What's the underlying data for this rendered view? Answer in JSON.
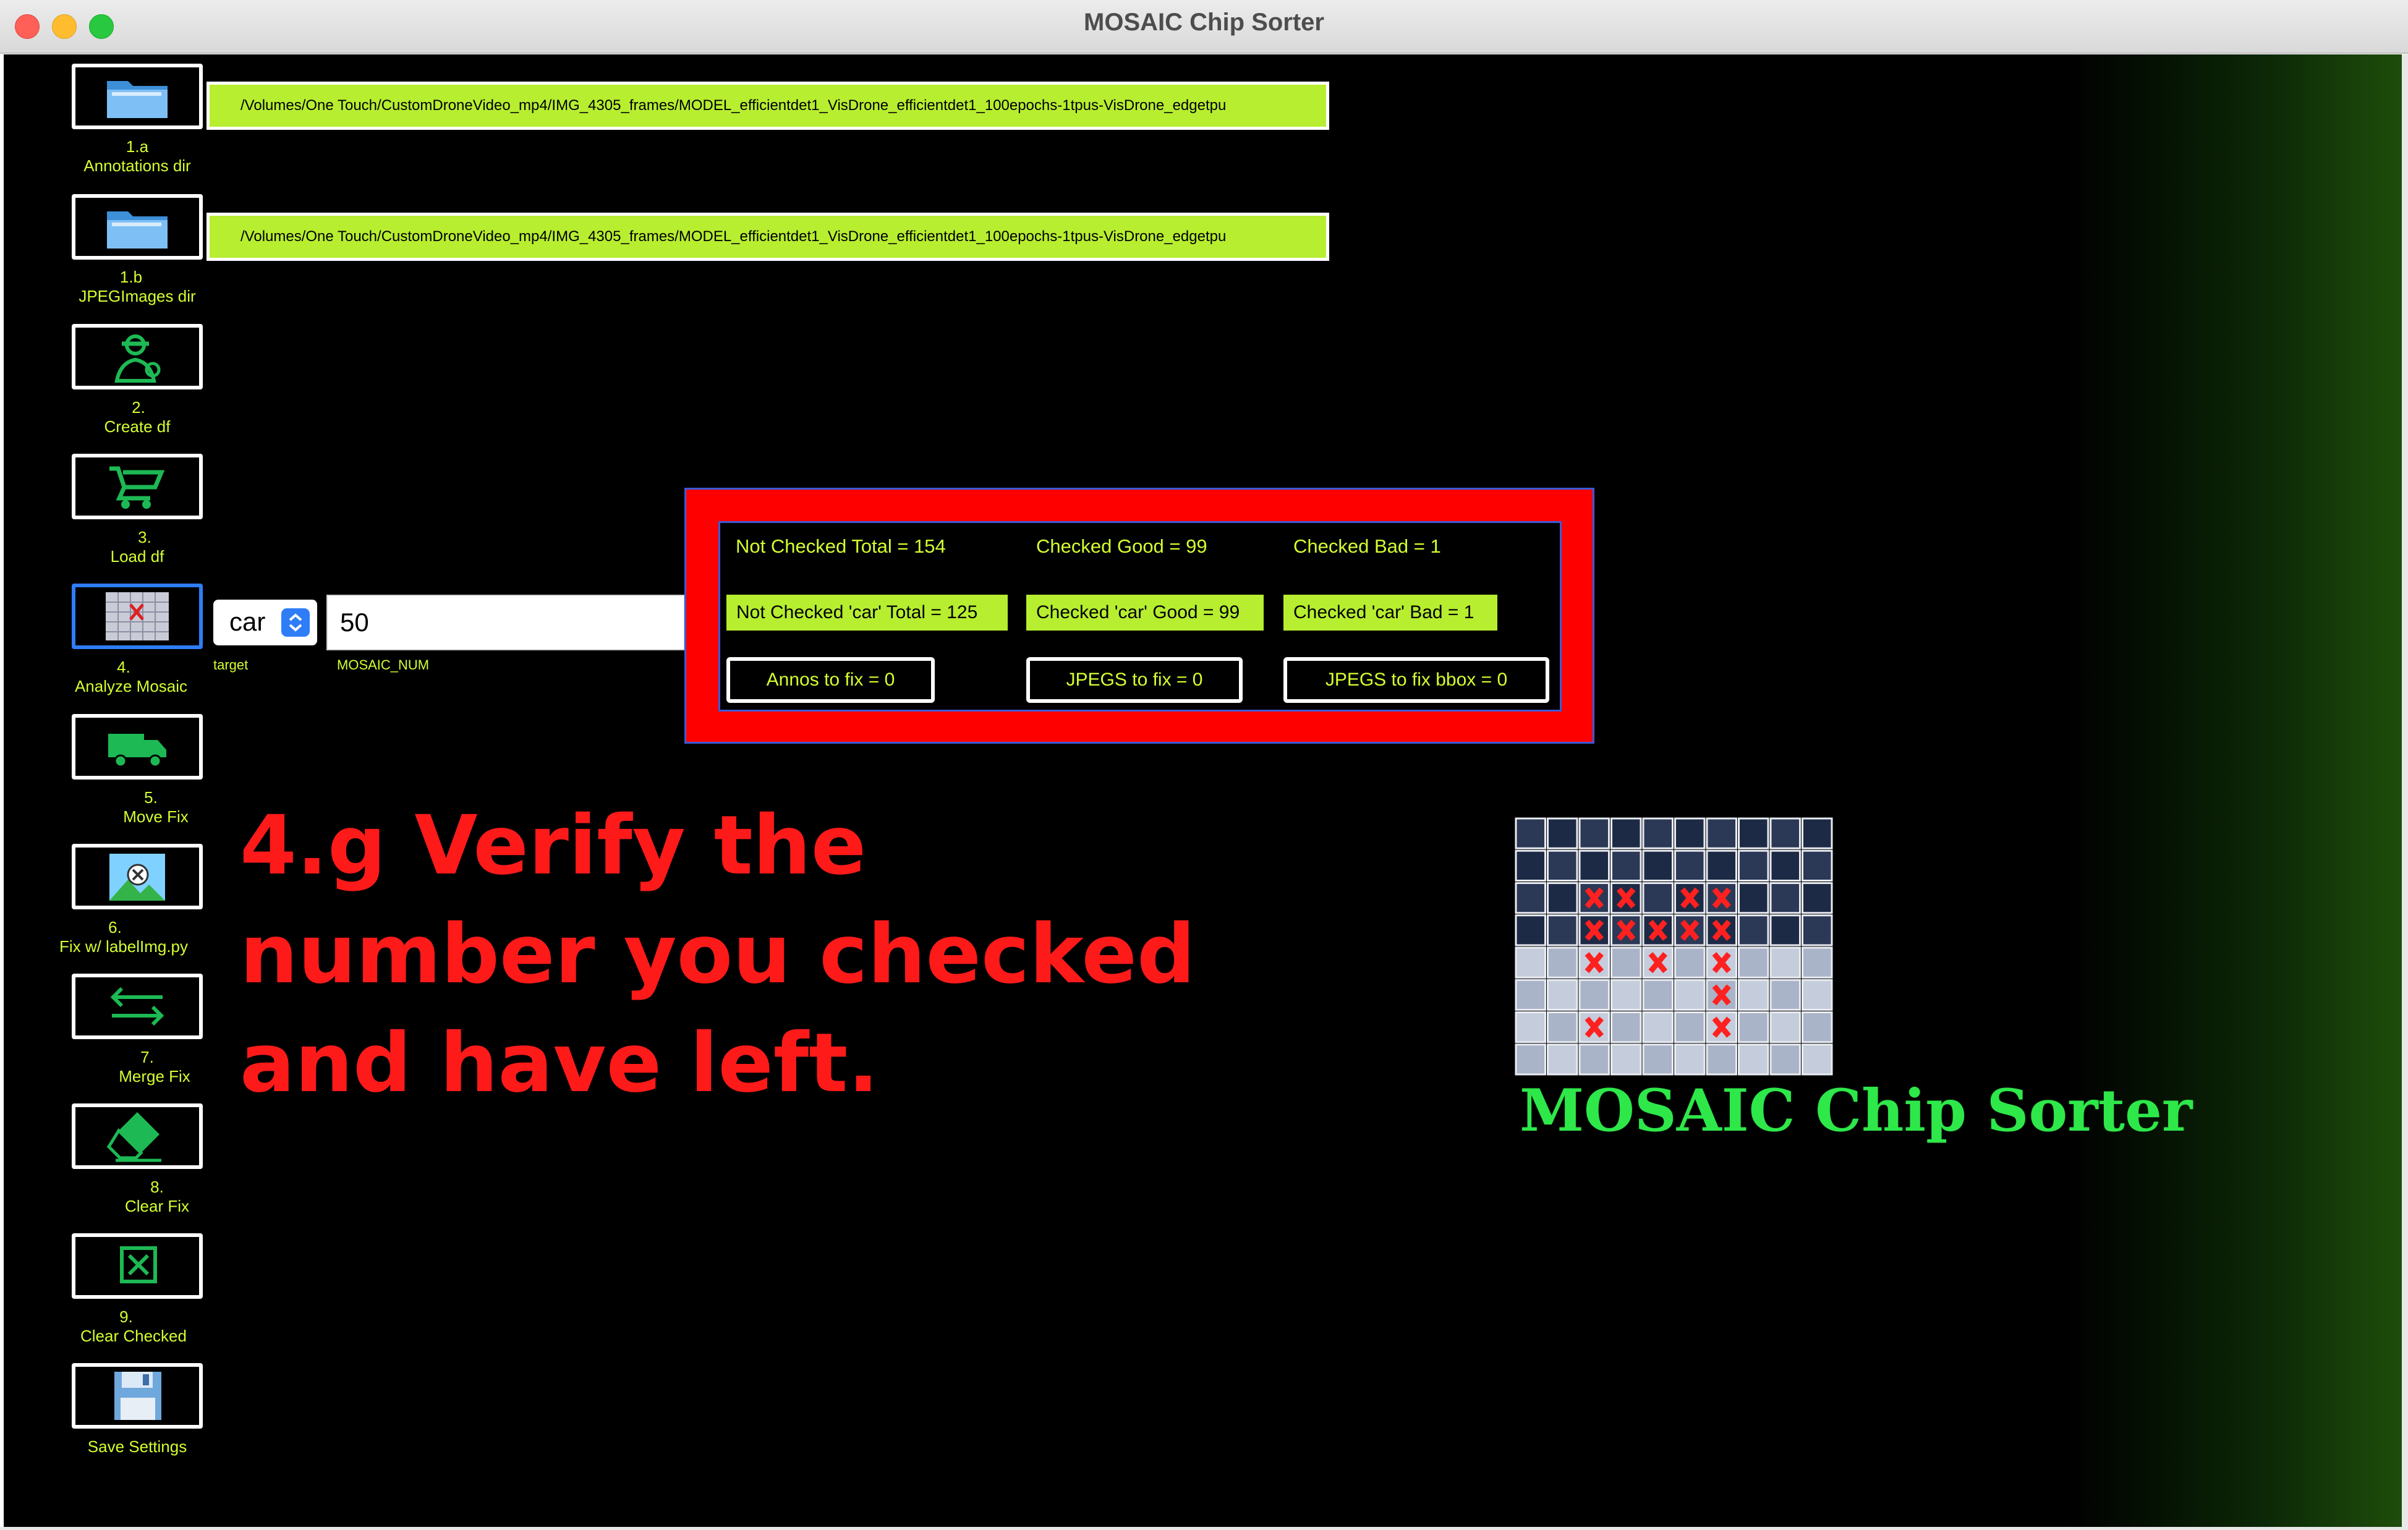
{
  "window": {
    "title": "MOSAIC Chip Sorter"
  },
  "sidebar": {
    "items": [
      {
        "num": "1.a",
        "label": "Annotations dir",
        "icon": "folder-icon"
      },
      {
        "num": "1.b",
        "label": "JPEGImages dir",
        "icon": "folder-icon"
      },
      {
        "num": "2.",
        "label": "Create df",
        "icon": "worker-icon"
      },
      {
        "num": "3.",
        "label": "Load df",
        "icon": "wheelbarrow-icon"
      },
      {
        "num": "4.",
        "label": "Analyze Mosaic",
        "icon": "mosaic-icon"
      },
      {
        "num": "5.",
        "label": "Move Fix",
        "icon": "truck-icon"
      },
      {
        "num": "6.",
        "label": "Fix w/ labelImg.py",
        "icon": "image-edit-icon"
      },
      {
        "num": "7.",
        "label": "Merge Fix",
        "icon": "swap-arrows-icon"
      },
      {
        "num": "8.",
        "label": "Clear Fix",
        "icon": "eraser-icon"
      },
      {
        "num": "9.",
        "label": "Clear Checked",
        "icon": "x-box-icon"
      },
      {
        "num": "",
        "label": "Save Settings",
        "icon": "floppy-disk-icon"
      }
    ]
  },
  "paths": {
    "annotations_dir": "/Volumes/One Touch/CustomDroneVideo_mp4/IMG_4305_frames/MODEL_efficientdet1_VisDrone_efficientdet1_100epochs-1tpus-VisDrone_edgetpu",
    "jpeg_dir": "/Volumes/One Touch/CustomDroneVideo_mp4/IMG_4305_frames/MODEL_efficientdet1_VisDrone_efficientdet1_100epochs-1tpus-VisDrone_edgetpu"
  },
  "analyze": {
    "target_value": "car",
    "target_caption": "target",
    "mosaic_num_value": "50",
    "mosaic_num_caption": "MOSAIC_NUM"
  },
  "stats": {
    "not_checked_total": "Not Checked Total = 154",
    "checked_good": "Checked Good = 99",
    "checked_bad": "Checked Bad = 1",
    "not_checked_car_total": "Not Checked 'car' Total = 125",
    "checked_car_good": "Checked 'car' Good = 99",
    "checked_car_bad": "Checked 'car' Bad = 1",
    "annos_to_fix": "Annos to fix = 0",
    "jpegs_to_fix": "JPEGS to fix = 0",
    "jpegs_to_fix_bbox": "JPEGS to fix bbox = 0"
  },
  "annotation": {
    "lines": [
      "4.g  Verify the",
      "number you checked",
      "and have left."
    ]
  },
  "logo": {
    "text": "MOSAIC Chip Sorter"
  },
  "colors": {
    "accent_green": "#b7ee30",
    "label_green": "#d4ff30",
    "alert_red": "#ff0000",
    "logo_green": "#2ee84a"
  }
}
